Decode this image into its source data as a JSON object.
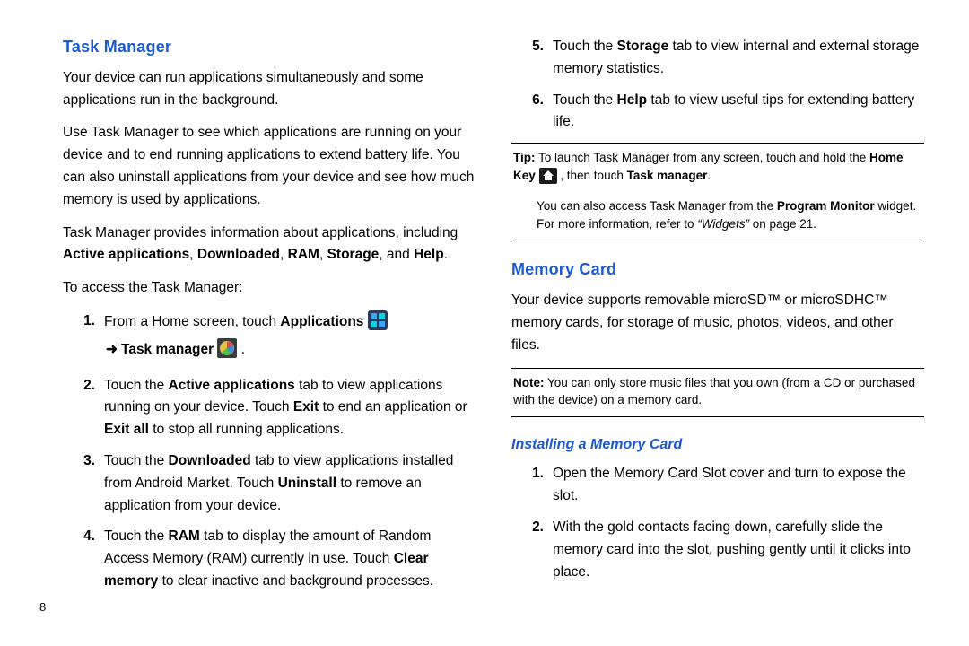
{
  "left": {
    "h": "Task Manager",
    "p1": "Your device can run applications simultaneously and some applications run in the background.",
    "p2": "Use Task Manager to see which applications are running on your device and to end running applications to extend battery life. You can also uninstall applications from your device and see how much memory is used by applications.",
    "p3a": "Task Manager provides information about applications, including ",
    "p3b": "Active applications",
    "p3c": "Downloaded",
    "p3d": "RAM",
    "p3e": "Storage",
    "p3f": "Help",
    "p4": "To access the Task Manager:",
    "s1a": "From a Home screen, touch ",
    "s1b": "Applications",
    "s1c": "Task manager",
    "s2a": "Touch the ",
    "s2b": "Active applications",
    "s2c": " tab to view applications running on your device. Touch ",
    "s2d": "Exit",
    "s2e": " to end an application or ",
    "s2f": "Exit all",
    "s2g": " to stop all running applications.",
    "s3a": "Touch the ",
    "s3b": "Downloaded",
    "s3c": " tab to view applications installed from Android Market. Touch ",
    "s3d": "Uninstall",
    "s3e": " to remove an application from your device.",
    "s4a": "Touch the ",
    "s4b": "RAM",
    "s4c": " tab to display the amount of Random Access Memory (RAM) currently in use. Touch ",
    "s4d": "Clear memory",
    "s4e": " to clear inactive and background processes."
  },
  "right": {
    "s5a": "Touch the ",
    "s5b": "Storage",
    "s5c": " tab to view internal and external storage memory statistics.",
    "s6a": "Touch the ",
    "s6b": "Help",
    "s6c": " tab to view useful tips for extending battery life.",
    "tipLabel": "Tip:",
    "tip1": " To launch Task Manager from any screen, touch and hold the ",
    "tip2": "Home Key",
    "tip3": " , then touch ",
    "tip4": "Task manager",
    "tip5": ".",
    "tipMore1": "You can also access Task Manager from the ",
    "tipMore2": "Program Monitor",
    "tipMore3": " widget. For more information, refer to ",
    "tipMore4": "“Widgets”",
    "tipMore5": "  on page 21.",
    "h2": "Memory Card",
    "mp1": "Your device supports removable microSD™ or microSDHC™ memory cards, for storage of music, photos, videos, and other files.",
    "noteLabel": "Note:",
    "note1": " You can only store music files that you own (from a CD or purchased with the device) on a memory card.",
    "h3": "Installing a Memory Card",
    "i1": "Open the Memory Card Slot cover and turn to expose the slot.",
    "i2": "With the gold contacts facing down, carefully slide the memory card into the slot, pushing gently until it clicks into place."
  },
  "pagenum": "8",
  "nums": {
    "n1": "1.",
    "n2": "2.",
    "n3": "3.",
    "n4": "4.",
    "n5": "5.",
    "n6": "6."
  },
  "misc": {
    "comma": ", ",
    "and": ", and ",
    "period": ".",
    "arrow": "➜"
  }
}
